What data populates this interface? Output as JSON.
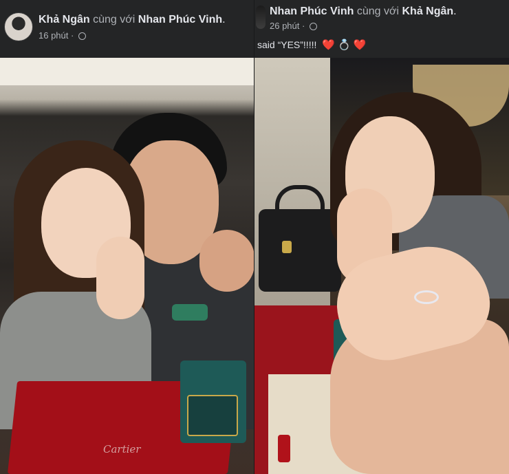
{
  "posts": [
    {
      "author": "Khả Ngân",
      "connector": "cùng với",
      "tagged": "Nhan Phúc Vinh",
      "period": ".",
      "time": "16 phút",
      "separator": "·",
      "caption": ""
    },
    {
      "author": "Nhan Phúc Vinh",
      "connector": "cùng với",
      "tagged": "Khả Ngân",
      "period": ".",
      "time": "26 phút",
      "separator": "·",
      "caption": "said “YES”!!!!!",
      "caption_emojis": [
        "❤️",
        "💍",
        "❤️"
      ]
    }
  ],
  "photo_text": {
    "box_brand": "Cartier"
  },
  "colors": {
    "background": "#242526",
    "text_primary": "#e4e6eb",
    "text_secondary": "#b0b3b8"
  },
  "icons": {
    "privacy": "globe-icon"
  }
}
